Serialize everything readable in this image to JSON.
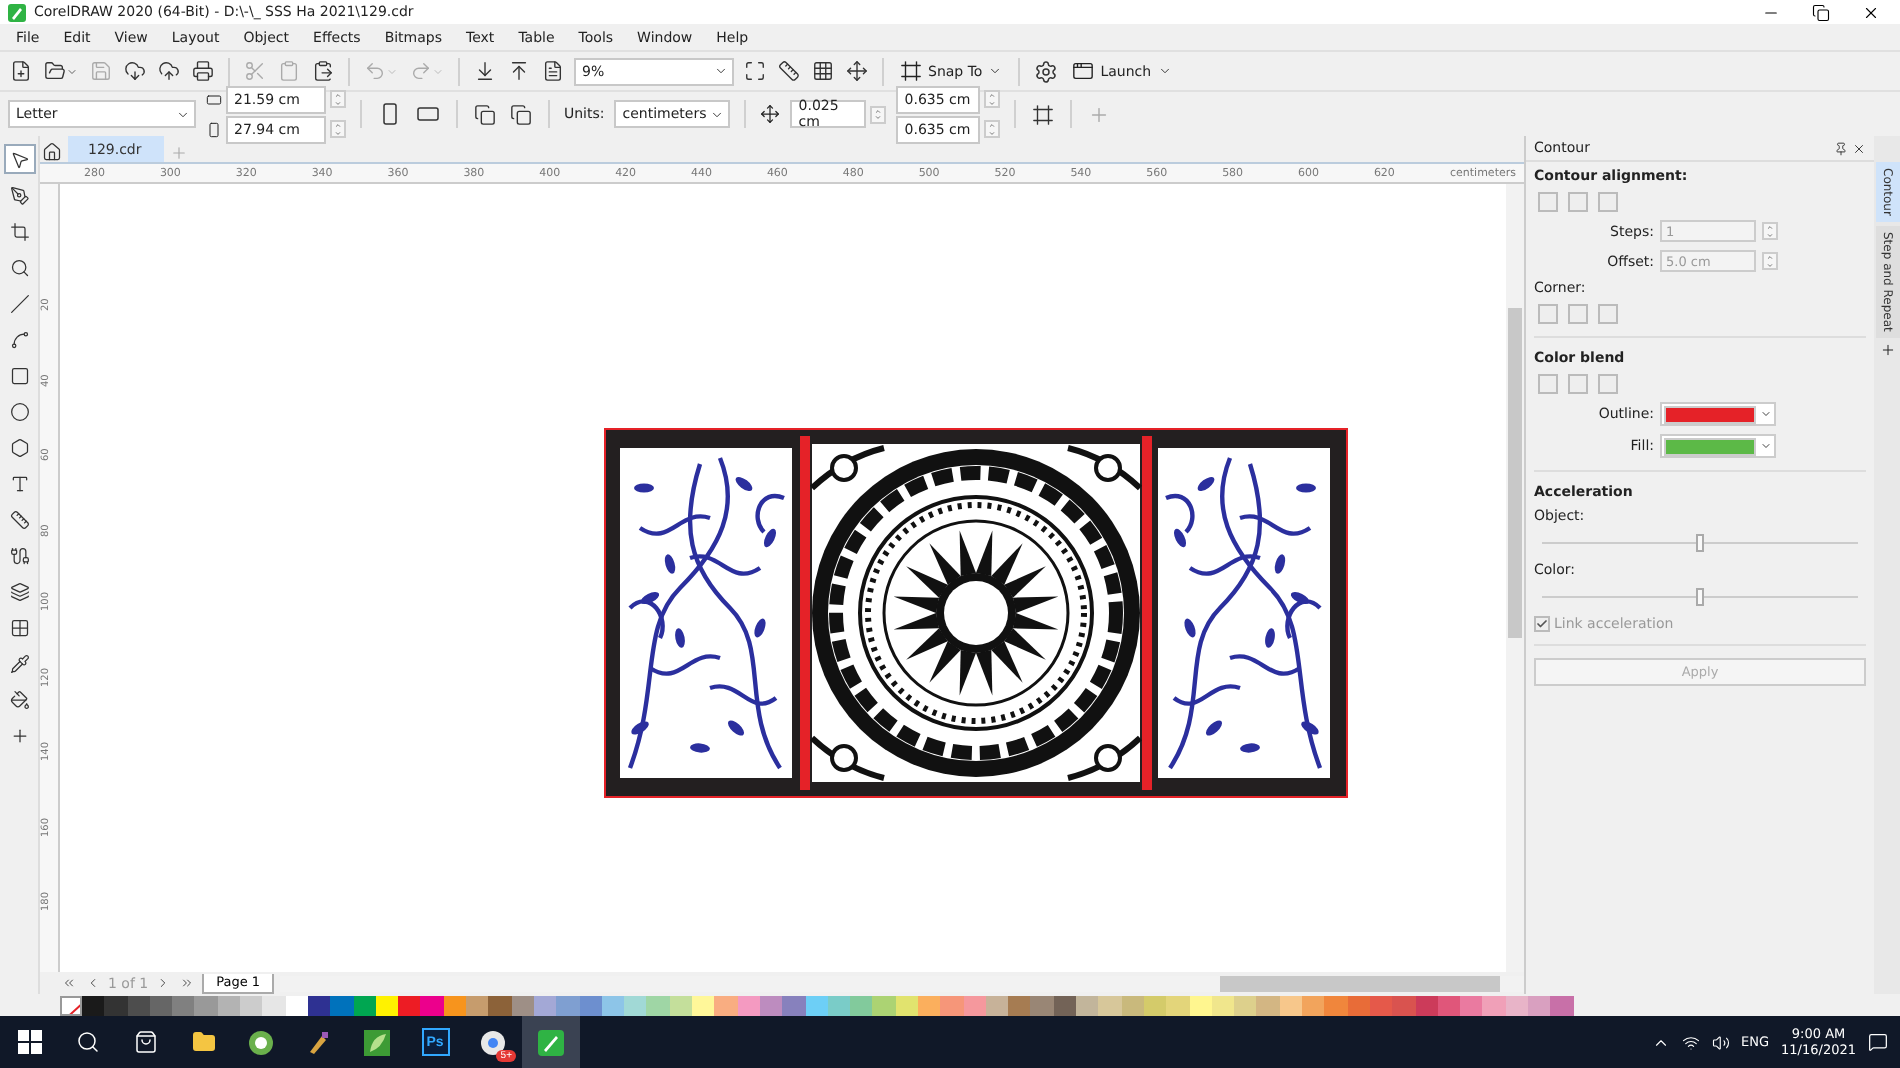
{
  "window": {
    "title": "CorelDRAW 2020 (64-Bit) - D:\\-\\_ SSS Ha 2021\\129.cdr"
  },
  "menu": [
    "File",
    "Edit",
    "View",
    "Layout",
    "Object",
    "Effects",
    "Bitmaps",
    "Text",
    "Table",
    "Tools",
    "Window",
    "Help"
  ],
  "toolbar": {
    "zoom": "9%",
    "snap": "Snap To",
    "launch": "Launch"
  },
  "property_bar": {
    "page_size": "Letter",
    "width": "21.59 cm",
    "height": "27.94 cm",
    "units_label": "Units:",
    "units": "centimeters",
    "nudge": "0.025 cm",
    "dup_x": "0.635 cm",
    "dup_y": "0.635 cm"
  },
  "document_tabs": [
    {
      "label": "129.cdr",
      "selected": true
    }
  ],
  "rulers": {
    "horizontal": [
      "280",
      "300",
      "320",
      "340",
      "360",
      "380",
      "400",
      "420",
      "440",
      "460",
      "480",
      "500",
      "520",
      "540",
      "560",
      "580",
      "600",
      "620"
    ],
    "unit": "centimeters",
    "vertical": [
      "20",
      "40",
      "60",
      "80",
      "100",
      "120",
      "140",
      "160",
      "180"
    ]
  },
  "toolbox": [
    {
      "kind": "pick",
      "selected": true
    },
    {
      "kind": "shape",
      "selected": false
    },
    {
      "kind": "crop",
      "selected": false
    },
    {
      "kind": "zoom",
      "selected": false
    },
    {
      "kind": "freehand",
      "selected": false
    },
    {
      "kind": "artistic",
      "selected": false
    },
    {
      "kind": "rectangle",
      "selected": false
    },
    {
      "kind": "ellipse",
      "selected": false
    },
    {
      "kind": "polygon",
      "selected": false
    },
    {
      "kind": "text",
      "selected": false
    },
    {
      "kind": "dimension",
      "selected": false
    },
    {
      "kind": "connector",
      "selected": false
    },
    {
      "kind": "shadow",
      "selected": false
    },
    {
      "kind": "transparency",
      "selected": false
    },
    {
      "kind": "eyedropper",
      "selected": false
    },
    {
      "kind": "fill",
      "selected": false
    },
    {
      "kind": "add",
      "selected": false
    }
  ],
  "docker": {
    "title": "Contour",
    "alignment_heading": "Contour alignment:",
    "steps": {
      "label": "Steps:",
      "value": "1",
      "disabled": true
    },
    "offset": {
      "label": "Offset:",
      "value": "5.0 cm",
      "disabled": true
    },
    "corner_heading": "Corner:",
    "color_blend_heading": "Color blend",
    "outline": {
      "label": "Outline:",
      "color": "#e52228"
    },
    "fill": {
      "label": "Fill:",
      "color": "#5cb947"
    },
    "acceleration_heading": "Acceleration",
    "sliders": [
      {
        "label": "Object:",
        "level": 0.5
      },
      {
        "label": "Color:",
        "level": 0.5
      }
    ],
    "link_acceleration": {
      "label": "Link acceleration",
      "checked": true,
      "disabled": true
    },
    "apply": {
      "label": "Apply",
      "disabled": true
    }
  },
  "docker_tabs": [
    {
      "label": "Contour",
      "selected": true
    },
    {
      "label": "Step and Repeat",
      "selected": false
    }
  ],
  "page_nav": {
    "counter": "1 of 1",
    "page_tab": "Page 1"
  },
  "palette": [
    {
      "color": "#1a1a1a"
    },
    {
      "color": "#333333"
    },
    {
      "color": "#4d4d4d"
    },
    {
      "color": "#666666"
    },
    {
      "color": "#808080"
    },
    {
      "color": "#999999"
    },
    {
      "color": "#b3b3b3"
    },
    {
      "color": "#cccccc"
    },
    {
      "color": "#e6e6e6"
    },
    {
      "color": "#ffffff"
    },
    {
      "color": "#2e3192"
    },
    {
      "color": "#0072bc"
    },
    {
      "color": "#00a651"
    },
    {
      "color": "#fff200"
    },
    {
      "color": "#ed1c24"
    },
    {
      "color": "#ec008c"
    },
    {
      "color": "#f7941d"
    },
    {
      "color": "#c69c6d"
    },
    {
      "color": "#8c6239"
    },
    {
      "color": "#9e8f86"
    },
    {
      "color": "#a3a8d6"
    },
    {
      "color": "#7f9fd1"
    },
    {
      "color": "#6d8fcf"
    },
    {
      "color": "#8dc5e8"
    },
    {
      "color": "#a1d9d6"
    },
    {
      "color": "#9fd6a5"
    },
    {
      "color": "#c4df9b"
    },
    {
      "color": "#fff799"
    },
    {
      "color": "#f9ad81"
    },
    {
      "color": "#f49ac1"
    },
    {
      "color": "#bd8cbf"
    },
    {
      "color": "#8781bd"
    },
    {
      "color": "#6dcff6"
    },
    {
      "color": "#7accc8"
    },
    {
      "color": "#82ca9c"
    },
    {
      "color": "#acd373"
    },
    {
      "color": "#e1e36e"
    },
    {
      "color": "#fbaf5d"
    },
    {
      "color": "#f69679"
    },
    {
      "color": "#f5989d"
    },
    {
      "color": "#c7b299"
    },
    {
      "color": "#a67c52"
    },
    {
      "color": "#998675"
    },
    {
      "color": "#736357"
    },
    {
      "color": "#c2b59b"
    },
    {
      "color": "#d7c79a"
    },
    {
      "color": "#c9b97c"
    },
    {
      "color": "#d4cb6a"
    },
    {
      "color": "#e3d57a"
    },
    {
      "color": "#fff68f"
    },
    {
      "color": "#f0e68c"
    },
    {
      "color": "#ddd08c"
    },
    {
      "color": "#d3b683"
    },
    {
      "color": "#f7c78b"
    },
    {
      "color": "#f2a45c"
    },
    {
      "color": "#f0863c"
    },
    {
      "color": "#e86c38"
    },
    {
      "color": "#e5594a"
    },
    {
      "color": "#d9534f"
    },
    {
      "color": "#cc3b5a"
    },
    {
      "color": "#e0567a"
    },
    {
      "color": "#ea7aa0"
    },
    {
      "color": "#f0a0b8"
    },
    {
      "color": "#e8b4c8"
    },
    {
      "color": "#d9a0c0"
    },
    {
      "color": "#c870a8"
    }
  ],
  "taskbar": {
    "apps": [
      {
        "kind": "start",
        "active": false
      },
      {
        "kind": "search",
        "active": false
      },
      {
        "kind": "store",
        "active": false
      },
      {
        "kind": "explorer",
        "active": false
      },
      {
        "kind": "green-circle",
        "active": false
      },
      {
        "kind": "tool",
        "active": false
      },
      {
        "kind": "corel-alt",
        "active": false
      },
      {
        "kind": "photoshop",
        "label": "Ps",
        "active": false
      },
      {
        "kind": "browser",
        "badge": "5+",
        "active": false
      },
      {
        "kind": "corel",
        "active": true
      }
    ],
    "language": "ENG",
    "time": "9:00 AM",
    "date": "11/16/2021"
  }
}
